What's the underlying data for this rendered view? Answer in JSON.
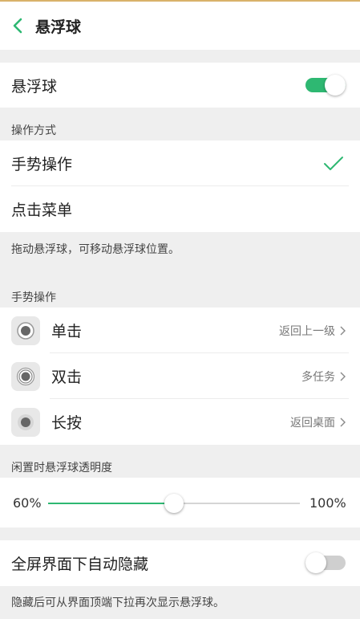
{
  "header": {
    "title": "悬浮球",
    "back_icon": "chevron-left-icon"
  },
  "colors": {
    "accent": "#2eb872",
    "off_track": "#cfcfcf"
  },
  "main_toggle": {
    "label": "悬浮球",
    "on": true
  },
  "operation": {
    "section_label": "操作方式",
    "options": [
      {
        "label": "手势操作",
        "selected": true
      },
      {
        "label": "点击菜单",
        "selected": false
      }
    ],
    "note": "拖动悬浮球，可移动悬浮球位置。"
  },
  "gestures": {
    "section_label": "手势操作",
    "items": [
      {
        "label": "单击",
        "value": "返回上一级",
        "icon": "single-tap-icon"
      },
      {
        "label": "双击",
        "value": "多任务",
        "icon": "double-tap-icon"
      },
      {
        "label": "长按",
        "value": "返回桌面",
        "icon": "long-press-icon"
      }
    ]
  },
  "opacity": {
    "section_label": "闲置时悬浮球透明度",
    "min_label": "60%",
    "max_label": "100%",
    "level": 0.5
  },
  "auto_hide": {
    "label": "全屏界面下自动隐藏",
    "on": false,
    "note": "隐藏后可从界面顶端下拉再次显示悬浮球。"
  }
}
